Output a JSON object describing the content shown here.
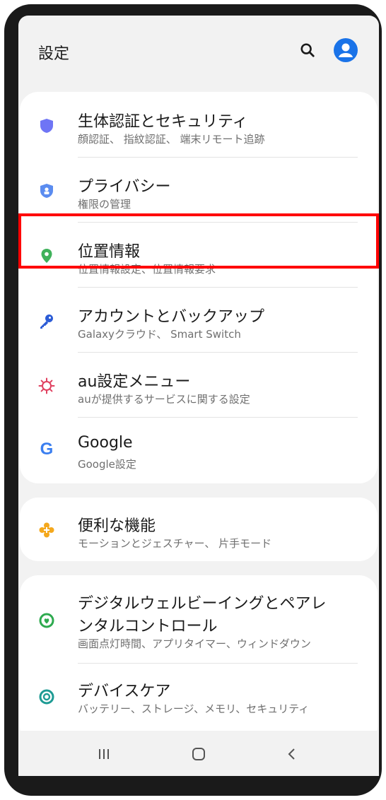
{
  "header": {
    "title": "設定"
  },
  "colors": {
    "accent": "#1a73e8",
    "highlight": "#ff0000"
  },
  "card1": [
    {
      "label": "生体認証とセキュリティ",
      "sub": "顔認証、 指紋認証、 端末リモート追跡",
      "icon": "shield-icon",
      "color": "#6f75f5"
    },
    {
      "label": "プライバシー",
      "sub": "権限の管理",
      "icon": "privacy-shield-icon",
      "color": "#5b8cf0"
    },
    {
      "label": "位置情報",
      "sub": "位置情報設定、位置情報要求",
      "icon": "location-pin-icon",
      "color": "#3fb25b"
    },
    {
      "label": "アカウントとバックアップ",
      "sub": "Galaxyクラウド、 Smart Switch",
      "icon": "key-icon",
      "color": "#2c5cd6"
    },
    {
      "label": "au設定メニュー",
      "sub": "auが提供するサービスに関する設定",
      "icon": "sun-gear-icon",
      "color": "#e0405f"
    },
    {
      "label": "Google",
      "sub": "Google設定",
      "icon": "google-icon",
      "color": "#3b7ff0"
    }
  ],
  "card2": [
    {
      "label": "便利な機能",
      "sub": "モーションとジェスチャー、 片手モード",
      "icon": "plus-gear-icon",
      "color": "#f4a81d"
    }
  ],
  "card3": [
    {
      "label": "デジタルウェルビーイングとペアレ",
      "label2": "ンタルコントロール",
      "sub": "画面点灯時間、アプリタイマー、ウィンドダウン",
      "icon": "wellbeing-icon",
      "color": "#2eaa4f"
    },
    {
      "label": "デバイスケア",
      "sub": "バッテリー、ストレージ、メモリ、セキュリティ",
      "icon": "device-care-icon",
      "color": "#1e9b94"
    }
  ]
}
